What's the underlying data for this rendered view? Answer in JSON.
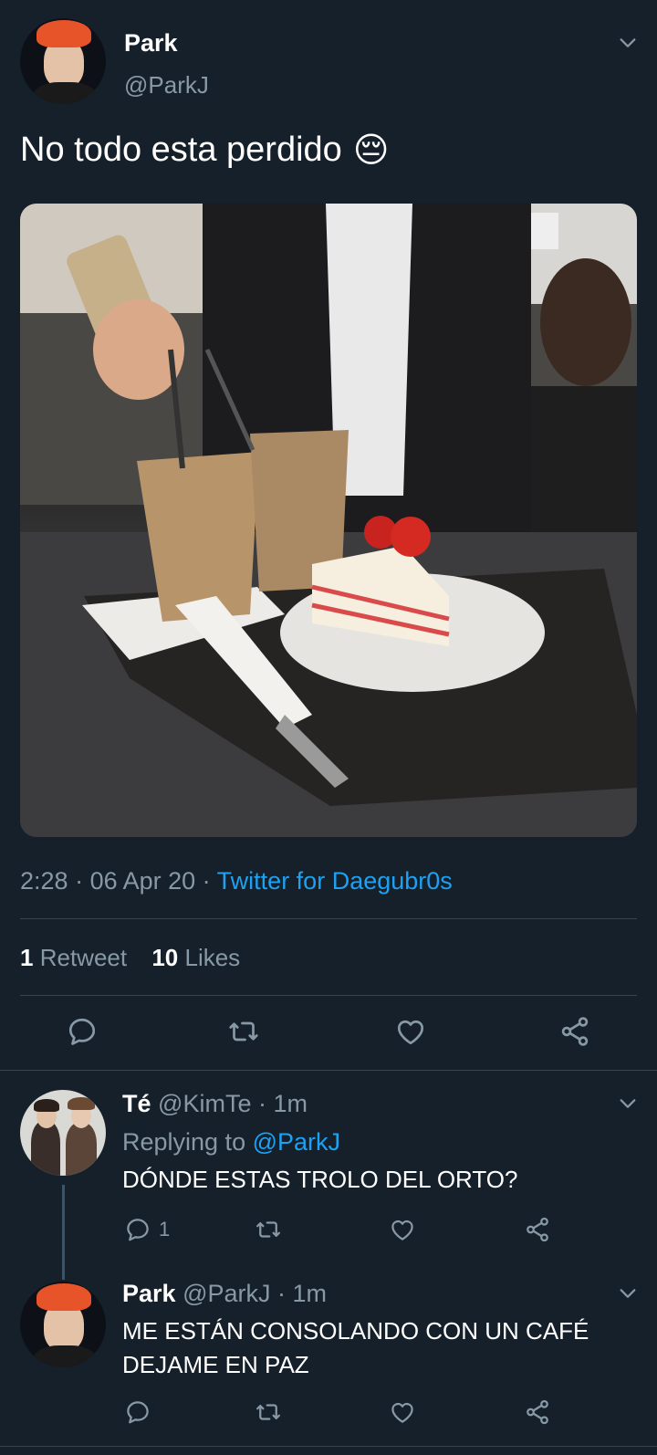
{
  "tweet": {
    "author_name": "Park",
    "author_handle": "@ParkJ",
    "text": "No todo esta perdido",
    "emoji": "😔",
    "time": "2:28",
    "date": "06 Apr 20",
    "source": "Twitter for Daegubr0s",
    "retweet_count": "1",
    "retweet_label": "Retweet",
    "like_count": "10",
    "like_label": "Likes"
  },
  "replies": [
    {
      "name": "Té",
      "handle": "@KimTe",
      "time": "1m",
      "replying_prefix": "Replying to",
      "replying_handle": "@ParkJ",
      "text": "DÓNDE ESTAS TROLO DEL ORTO?",
      "reply_count": "1"
    },
    {
      "name": "Park",
      "handle": "@ParkJ",
      "time": "1m",
      "text": "ME ESTÁN CONSOLANDO CON UN CAFÉ DEJAME EN PAZ"
    }
  ],
  "icons": {
    "reply": "reply-icon",
    "retweet": "retweet-icon",
    "like": "heart-icon",
    "share": "share-icon",
    "more": "chevron-down-icon"
  },
  "colors": {
    "background": "#15202b",
    "accent": "#1da1f2",
    "muted": "#8899a6",
    "divider": "#38444d"
  }
}
